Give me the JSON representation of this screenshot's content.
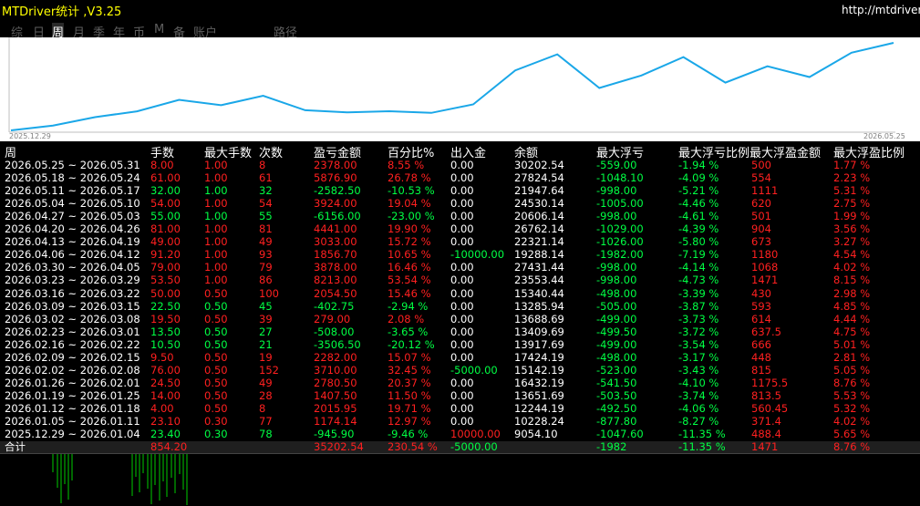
{
  "app": {
    "title": "MTDriver统计 ,V3.25",
    "url": "http://mtdriver."
  },
  "tabs": [
    {
      "label": "综",
      "active": false
    },
    {
      "label": "日",
      "active": false
    },
    {
      "label": "周",
      "active": true
    },
    {
      "label": "月",
      "active": false
    },
    {
      "label": "季",
      "active": false
    },
    {
      "label": "年",
      "active": false
    },
    {
      "label": "币",
      "active": false
    },
    {
      "label": "M",
      "active": false
    },
    {
      "label": "备",
      "active": false
    },
    {
      "label": "账户",
      "active": false
    },
    {
      "label": "路径",
      "active": false
    }
  ],
  "equity_chart": {
    "start_date": "2025.12.29",
    "end_date": "2026.05.25",
    "line_color": "#1aa7e8",
    "values": [
      9054.1,
      10228.24,
      12244.19,
      13651.69,
      16432.19,
      15142.19,
      17424.19,
      13917.69,
      13409.69,
      13688.69,
      13285.94,
      15340.44,
      23553.44,
      27431.44,
      19288.14,
      22321.14,
      26762.14,
      20606.14,
      24530.14,
      21947.64,
      27824.54,
      30202.54
    ]
  },
  "table": {
    "headers": {
      "week": "周",
      "lots": "手数",
      "max_lots": "最大手数",
      "count": "次数",
      "pnl": "盈亏金额",
      "pct": "百分比%",
      "deposit": "出入金",
      "balance": "余额",
      "max_float_loss": "最大浮亏",
      "max_float_loss_pct": "最大浮亏比例",
      "max_float_profit": "最大浮盈金额",
      "max_float_profit_pct": "最大浮盈比例"
    },
    "rows": [
      {
        "week": "2026.05.25 ~ 2026.05.31",
        "lots": "8.00",
        "max_lots": "1.00",
        "count": "8",
        "pnl": "2378.00",
        "pct": "8.55 %",
        "deposit": "0.00",
        "balance": "30202.54",
        "mfl": "-559.00",
        "mflp": "-1.94 %",
        "mfp": "500",
        "mfpp": "1.77 %",
        "c": "r"
      },
      {
        "week": "2026.05.18 ~ 2026.05.24",
        "lots": "61.00",
        "max_lots": "1.00",
        "count": "61",
        "pnl": "5876.90",
        "pct": "26.78 %",
        "deposit": "0.00",
        "balance": "27824.54",
        "mfl": "-1048.10",
        "mflp": "-4.09 %",
        "mfp": "554",
        "mfpp": "2.23 %",
        "c": "r"
      },
      {
        "week": "2026.05.11 ~ 2026.05.17",
        "lots": "32.00",
        "max_lots": "1.00",
        "count": "32",
        "pnl": "-2582.50",
        "pct": "-10.53 %",
        "deposit": "0.00",
        "balance": "21947.64",
        "mfl": "-998.00",
        "mflp": "-5.21 %",
        "mfp": "1111",
        "mfpp": "5.31 %",
        "c": "g"
      },
      {
        "week": "2026.05.04 ~ 2026.05.10",
        "lots": "54.00",
        "max_lots": "1.00",
        "count": "54",
        "pnl": "3924.00",
        "pct": "19.04 %",
        "deposit": "0.00",
        "balance": "24530.14",
        "mfl": "-1005.00",
        "mflp": "-4.46 %",
        "mfp": "620",
        "mfpp": "2.75 %",
        "c": "r"
      },
      {
        "week": "2026.04.27 ~ 2026.05.03",
        "lots": "55.00",
        "max_lots": "1.00",
        "count": "55",
        "pnl": "-6156.00",
        "pct": "-23.00 %",
        "deposit": "0.00",
        "balance": "20606.14",
        "mfl": "-998.00",
        "mflp": "-4.61 %",
        "mfp": "501",
        "mfpp": "1.99 %",
        "c": "g"
      },
      {
        "week": "2026.04.20 ~ 2026.04.26",
        "lots": "81.00",
        "max_lots": "1.00",
        "count": "81",
        "pnl": "4441.00",
        "pct": "19.90 %",
        "deposit": "0.00",
        "balance": "26762.14",
        "mfl": "-1029.00",
        "mflp": "-4.39 %",
        "mfp": "904",
        "mfpp": "3.56 %",
        "c": "r"
      },
      {
        "week": "2026.04.13 ~ 2026.04.19",
        "lots": "49.00",
        "max_lots": "1.00",
        "count": "49",
        "pnl": "3033.00",
        "pct": "15.72 %",
        "deposit": "0.00",
        "balance": "22321.14",
        "mfl": "-1026.00",
        "mflp": "-5.80 %",
        "mfp": "673",
        "mfpp": "3.27 %",
        "c": "r"
      },
      {
        "week": "2026.04.06 ~ 2026.04.12",
        "lots": "91.20",
        "max_lots": "1.00",
        "count": "93",
        "pnl": "1856.70",
        "pct": "10.65 %",
        "deposit": "-10000.00",
        "balance": "19288.14",
        "mfl": "-1982.00",
        "mflp": "-7.19 %",
        "mfp": "1180",
        "mfpp": "4.54 %",
        "c": "r",
        "dc": "g"
      },
      {
        "week": "2026.03.30 ~ 2026.04.05",
        "lots": "79.00",
        "max_lots": "1.00",
        "count": "79",
        "pnl": "3878.00",
        "pct": "16.46 %",
        "deposit": "0.00",
        "balance": "27431.44",
        "mfl": "-998.00",
        "mflp": "-4.14 %",
        "mfp": "1068",
        "mfpp": "4.02 %",
        "c": "r"
      },
      {
        "week": "2026.03.23 ~ 2026.03.29",
        "lots": "53.50",
        "max_lots": "1.00",
        "count": "86",
        "pnl": "8213.00",
        "pct": "53.54 %",
        "deposit": "0.00",
        "balance": "23553.44",
        "mfl": "-998.00",
        "mflp": "-4.73 %",
        "mfp": "1471",
        "mfpp": "8.15 %",
        "c": "r"
      },
      {
        "week": "2026.03.16 ~ 2026.03.22",
        "lots": "50.00",
        "max_lots": "0.50",
        "count": "100",
        "pnl": "2054.50",
        "pct": "15.46 %",
        "deposit": "0.00",
        "balance": "15340.44",
        "mfl": "-498.00",
        "mflp": "-3.39 %",
        "mfp": "430",
        "mfpp": "2.98 %",
        "c": "r"
      },
      {
        "week": "2026.03.09 ~ 2026.03.15",
        "lots": "22.50",
        "max_lots": "0.50",
        "count": "45",
        "pnl": "-402.75",
        "pct": "-2.94 %",
        "deposit": "0.00",
        "balance": "13285.94",
        "mfl": "-505.00",
        "mflp": "-3.87 %",
        "mfp": "593",
        "mfpp": "4.85 %",
        "c": "g"
      },
      {
        "week": "2026.03.02 ~ 2026.03.08",
        "lots": "19.50",
        "max_lots": "0.50",
        "count": "39",
        "pnl": "279.00",
        "pct": "2.08 %",
        "deposit": "0.00",
        "balance": "13688.69",
        "mfl": "-499.00",
        "mflp": "-3.73 %",
        "mfp": "614",
        "mfpp": "4.44 %",
        "c": "r"
      },
      {
        "week": "2026.02.23 ~ 2026.03.01",
        "lots": "13.50",
        "max_lots": "0.50",
        "count": "27",
        "pnl": "-508.00",
        "pct": "-3.65 %",
        "deposit": "0.00",
        "balance": "13409.69",
        "mfl": "-499.50",
        "mflp": "-3.72 %",
        "mfp": "637.5",
        "mfpp": "4.75 %",
        "c": "g"
      },
      {
        "week": "2026.02.16 ~ 2026.02.22",
        "lots": "10.50",
        "max_lots": "0.50",
        "count": "21",
        "pnl": "-3506.50",
        "pct": "-20.12 %",
        "deposit": "0.00",
        "balance": "13917.69",
        "mfl": "-499.00",
        "mflp": "-3.54 %",
        "mfp": "666",
        "mfpp": "5.01 %",
        "c": "g"
      },
      {
        "week": "2026.02.09 ~ 2026.02.15",
        "lots": "9.50",
        "max_lots": "0.50",
        "count": "19",
        "pnl": "2282.00",
        "pct": "15.07 %",
        "deposit": "0.00",
        "balance": "17424.19",
        "mfl": "-498.00",
        "mflp": "-3.17 %",
        "mfp": "448",
        "mfpp": "2.81 %",
        "c": "r"
      },
      {
        "week": "2026.02.02 ~ 2026.02.08",
        "lots": "76.00",
        "max_lots": "0.50",
        "count": "152",
        "pnl": "3710.00",
        "pct": "32.45 %",
        "deposit": "-5000.00",
        "balance": "15142.19",
        "mfl": "-523.00",
        "mflp": "-3.43 %",
        "mfp": "815",
        "mfpp": "5.05 %",
        "c": "r",
        "dc": "g"
      },
      {
        "week": "2026.01.26 ~ 2026.02.01",
        "lots": "24.50",
        "max_lots": "0.50",
        "count": "49",
        "pnl": "2780.50",
        "pct": "20.37 %",
        "deposit": "0.00",
        "balance": "16432.19",
        "mfl": "-541.50",
        "mflp": "-4.10 %",
        "mfp": "1175.5",
        "mfpp": "8.76 %",
        "c": "r"
      },
      {
        "week": "2026.01.19 ~ 2026.01.25",
        "lots": "14.00",
        "max_lots": "0.50",
        "count": "28",
        "pnl": "1407.50",
        "pct": "11.50 %",
        "deposit": "0.00",
        "balance": "13651.69",
        "mfl": "-503.50",
        "mflp": "-3.74 %",
        "mfp": "813.5",
        "mfpp": "5.53 %",
        "c": "r"
      },
      {
        "week": "2026.01.12 ~ 2026.01.18",
        "lots": "4.00",
        "max_lots": "0.50",
        "count": "8",
        "pnl": "2015.95",
        "pct": "19.71 %",
        "deposit": "0.00",
        "balance": "12244.19",
        "mfl": "-492.50",
        "mflp": "-4.06 %",
        "mfp": "560.45",
        "mfpp": "5.32 %",
        "c": "r"
      },
      {
        "week": "2026.01.05 ~ 2026.01.11",
        "lots": "23.10",
        "max_lots": "0.30",
        "count": "77",
        "pnl": "1174.14",
        "pct": "12.97 %",
        "deposit": "0.00",
        "balance": "10228.24",
        "mfl": "-877.80",
        "mflp": "-8.27 %",
        "mfp": "371.4",
        "mfpp": "4.02 %",
        "c": "r"
      },
      {
        "week": "2025.12.29 ~ 2026.01.04",
        "lots": "23.40",
        "max_lots": "0.30",
        "count": "78",
        "pnl": "-945.90",
        "pct": "-9.46 %",
        "deposit": "10000.00",
        "balance": "9054.10",
        "mfl": "-1047.60",
        "mflp": "-11.35 %",
        "mfp": "488.4",
        "mfpp": "5.65 %",
        "c": "g",
        "dc": "r"
      }
    ],
    "total": {
      "label": "合计",
      "lots": "854.20",
      "pnl": "35202.54",
      "pct": "230.54 %",
      "deposit": "-5000.00",
      "mfl": "-1982",
      "mflp": "-11.35 %",
      "mfp": "1471",
      "mfpp": "8.76 %"
    }
  },
  "colors": {
    "profit": "#ff2020",
    "loss": "#00ff44",
    "title": "#ffff00",
    "bars": "#00cc00"
  }
}
